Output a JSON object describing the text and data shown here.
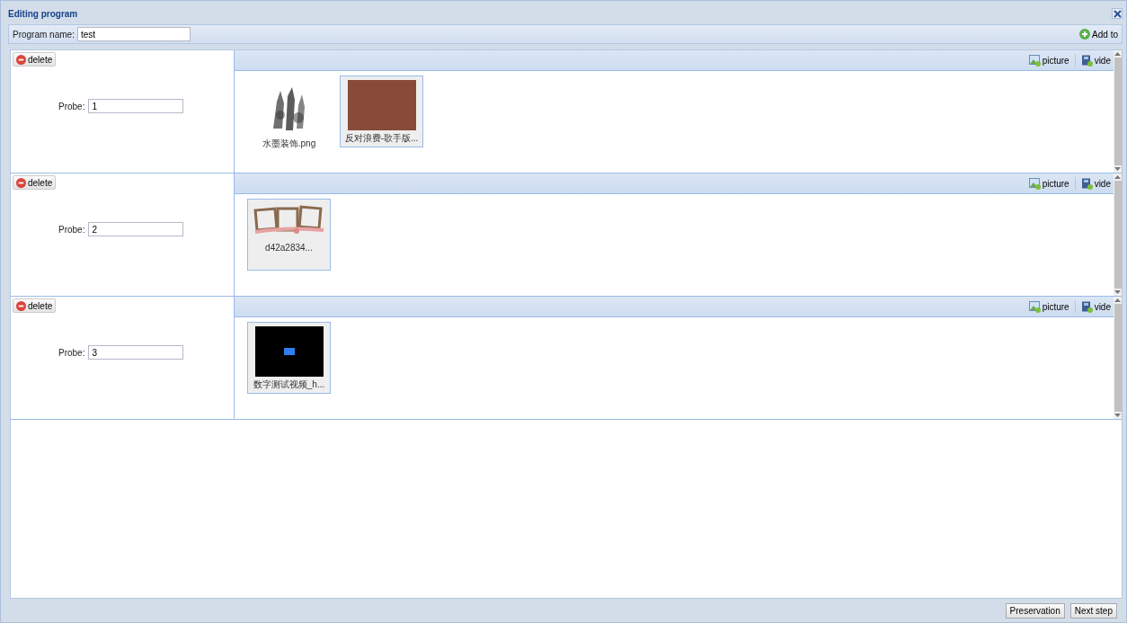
{
  "window": {
    "title": "Editing program"
  },
  "toolbar": {
    "name_label": "Program name:",
    "name_value": "test",
    "add_button": "Add to"
  },
  "regions": [
    {
      "delete_button": "delete",
      "probe_label": "Probe:",
      "probe_value": "1",
      "picture_button": "picture",
      "video_button": "vide",
      "media": [
        {
          "kind": "ink",
          "name": "水墨装饰.png"
        },
        {
          "kind": "photo",
          "name": "反对浪费-歌手版..."
        }
      ]
    },
    {
      "delete_button": "delete",
      "probe_label": "Probe:",
      "probe_value": "2",
      "picture_button": "picture",
      "video_button": "vide",
      "media": [
        {
          "kind": "frames",
          "name": "d42a2834..."
        }
      ]
    },
    {
      "delete_button": "delete",
      "probe_label": "Probe:",
      "probe_value": "3",
      "picture_button": "picture",
      "video_button": "vide",
      "media": [
        {
          "kind": "video",
          "name": "数字测试视频_h..."
        }
      ]
    }
  ],
  "footer": {
    "buttons": [
      "Preservation",
      "Next step"
    ]
  }
}
